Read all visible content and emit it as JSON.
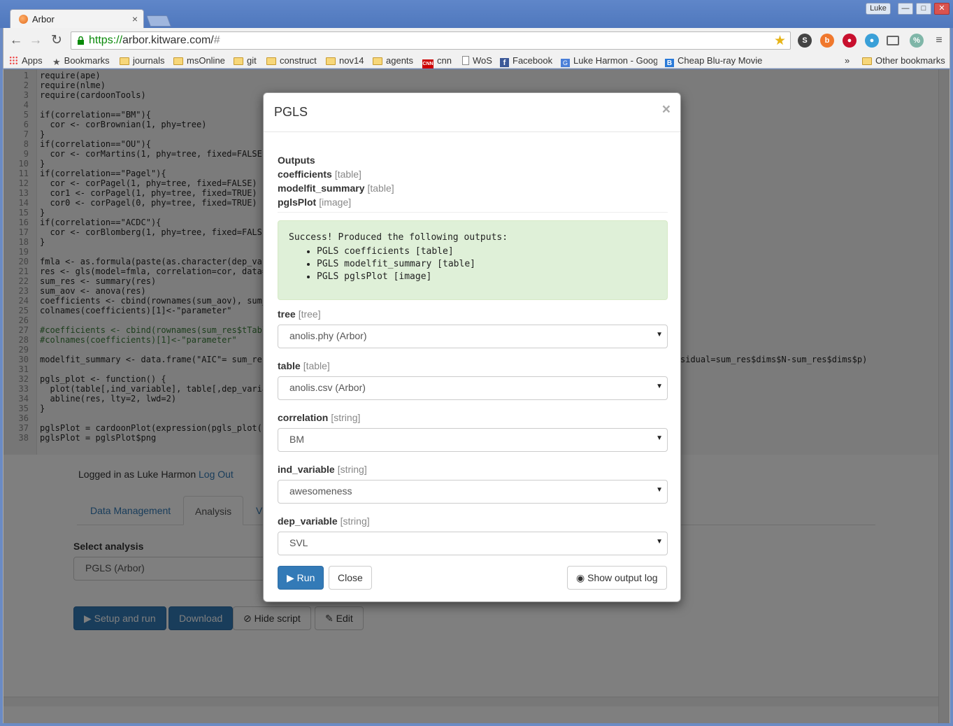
{
  "browser": {
    "tab_title": "Arbor",
    "tab_close": "×",
    "user_label": "Luke",
    "url_scheme": "https://",
    "url_host": "arbor.kitware.com/",
    "url_rest": "#",
    "bookmarks": [
      {
        "label": "Apps",
        "icon": "apps-grid-icon"
      },
      {
        "label": "Bookmarks",
        "icon": "star-icon"
      },
      {
        "label": "journals",
        "icon": "folder-icon"
      },
      {
        "label": "msOnline",
        "icon": "folder-icon"
      },
      {
        "label": "git",
        "icon": "folder-icon"
      },
      {
        "label": "construct",
        "icon": "folder-icon"
      },
      {
        "label": "nov14",
        "icon": "folder-icon"
      },
      {
        "label": "agents",
        "icon": "folder-icon"
      },
      {
        "label": "cnn",
        "icon": "cnn-icon"
      },
      {
        "label": "WoS",
        "icon": "page-icon"
      },
      {
        "label": "Facebook",
        "icon": "facebook-icon"
      },
      {
        "label": "Luke Harmon - Googl",
        "icon": "scholar-icon"
      },
      {
        "label": "Cheap Blu-ray Movie",
        "icon": "b-icon"
      }
    ],
    "overflow_chevron": "»",
    "other_bookmarks": "Other bookmarks"
  },
  "code_lines": [
    {
      "n": "1",
      "t": "require(ape)"
    },
    {
      "n": "2",
      "t": "require(nlme)"
    },
    {
      "n": "3",
      "t": "require(cardoonTools)"
    },
    {
      "n": "4",
      "t": ""
    },
    {
      "n": "5",
      "t": "if(correlation==\"BM\"){"
    },
    {
      "n": "6",
      "t": "  cor <- corBrownian(1, phy=tree)"
    },
    {
      "n": "7",
      "t": "}"
    },
    {
      "n": "8",
      "t": "if(correlation==\"OU\"){"
    },
    {
      "n": "9",
      "t": "  cor <- corMartins(1, phy=tree, fixed=FALSE)"
    },
    {
      "n": "10",
      "t": "}"
    },
    {
      "n": "11",
      "t": "if(correlation==\"Pagel\"){"
    },
    {
      "n": "12",
      "t": "  cor <- corPagel(1, phy=tree, fixed=FALSE)"
    },
    {
      "n": "13",
      "t": "  cor1 <- corPagel(1, phy=tree, fixed=TRUE)"
    },
    {
      "n": "14",
      "t": "  cor0 <- corPagel(0, phy=tree, fixed=TRUE)"
    },
    {
      "n": "15",
      "t": "}"
    },
    {
      "n": "16",
      "t": "if(correlation==\"ACDC\"){"
    },
    {
      "n": "17",
      "t": "  cor <- corBlomberg(1, phy=tree, fixed=FALSE)"
    },
    {
      "n": "18",
      "t": "}"
    },
    {
      "n": "19",
      "t": ""
    },
    {
      "n": "20",
      "t": "fmla <- as.formula(paste(as.character(dep_vari"
    },
    {
      "n": "21",
      "t": "res <- gls(model=fmla, correlation=cor, data=t"
    },
    {
      "n": "22",
      "t": "sum_res <- summary(res)"
    },
    {
      "n": "23",
      "t": "sum_aov <- anova(res)"
    },
    {
      "n": "24",
      "t": "coefficients <- cbind(rownames(sum_aov), sum_a"
    },
    {
      "n": "25",
      "t": "colnames(coefficients)[1]<-\"parameter\""
    },
    {
      "n": "26",
      "t": ""
    },
    {
      "n": "27",
      "t": "#coefficients <- cbind(rownames(sum_res$tTable"
    },
    {
      "n": "28",
      "t": "#colnames(coefficients)[1]<-\"parameter\""
    },
    {
      "n": "29",
      "t": ""
    },
    {
      "n": "30",
      "t": "modelfit_summary <- data.frame(\"AIC\"= sum_res$"
    },
    {
      "n": "31",
      "t": ""
    },
    {
      "n": "32",
      "t": "pgls_plot <- function() {"
    },
    {
      "n": "33",
      "t": "  plot(table[,ind_variable], table[,dep_variab"
    },
    {
      "n": "34",
      "t": "  abline(res, lty=2, lwd=2)"
    },
    {
      "n": "35",
      "t": "}"
    },
    {
      "n": "36",
      "t": ""
    },
    {
      "n": "37",
      "t": "pglsPlot = cardoonPlot(expression(pgls_plot()"
    },
    {
      "n": "38",
      "t": "pglsPlot = pglsPlot$png"
    }
  ],
  "code_tail_30": "sidual=sum_res$dims$N-sum_res$dims$p)",
  "app": {
    "logged_in_text": "Logged in as Luke Harmon",
    "logout_link": "Log Out",
    "tabs": [
      "Data Management",
      "Analysis",
      "Vi"
    ],
    "select_label": "Select analysis",
    "select_value": "PGLS (Arbor)",
    "buttons": {
      "setup": "Setup and run",
      "download": "Download",
      "hide_script": "Hide script",
      "edit": "Edit"
    }
  },
  "modal": {
    "title": "PGLS",
    "close_x": "×",
    "outputs_heading": "Outputs",
    "outputs": [
      {
        "name": "coefficients",
        "type": "[table]"
      },
      {
        "name": "modelfit_summary",
        "type": "[table]"
      },
      {
        "name": "pglsPlot",
        "type": "[image]"
      }
    ],
    "success_message": "Success! Produced the following outputs:",
    "success_items": [
      "PGLS coefficients [table]",
      "PGLS modelfit_summary [table]",
      "PGLS pglsPlot [image]"
    ],
    "fields": [
      {
        "name": "tree",
        "type": "[tree]",
        "value": "anolis.phy (Arbor)"
      },
      {
        "name": "table",
        "type": "[table]",
        "value": "anolis.csv (Arbor)"
      },
      {
        "name": "correlation",
        "type": "[string]",
        "value": "BM"
      },
      {
        "name": "ind_variable",
        "type": "[string]",
        "value": "awesomeness"
      },
      {
        "name": "dep_variable",
        "type": "[string]",
        "value": "SVL"
      }
    ],
    "run_label": "Run",
    "close_label": "Close",
    "show_log_label": "Show output log"
  }
}
